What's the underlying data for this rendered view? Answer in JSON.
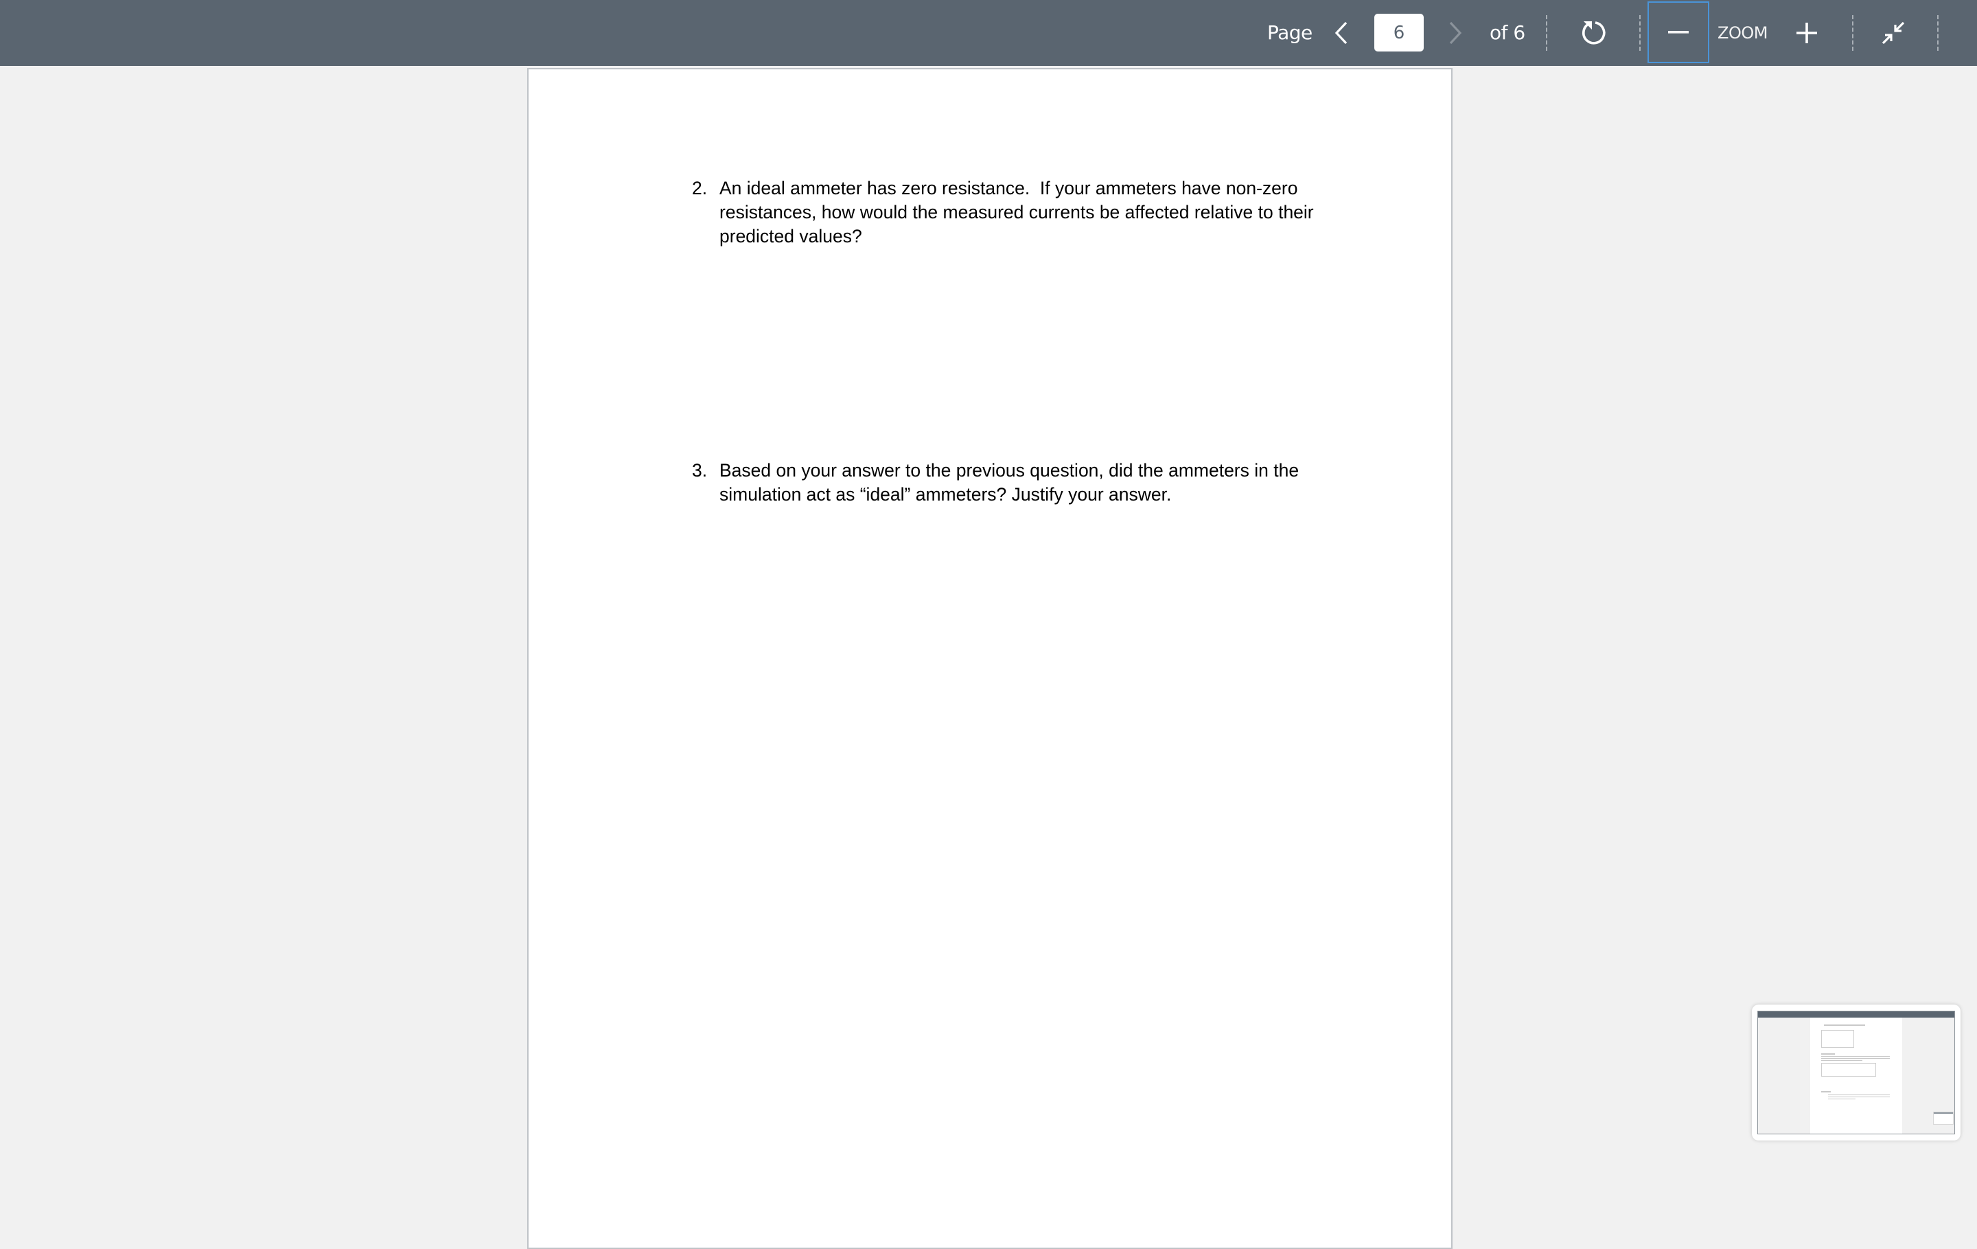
{
  "toolbar": {
    "page_label": "Page",
    "current_page": "6",
    "total_pages_label": "of 6",
    "zoom_label": "ZOOM",
    "icons": {
      "prev": "chevron-left-icon",
      "next": "chevron-right-icon",
      "rotate": "rotate-icon",
      "zoom_out": "minus-icon",
      "zoom_in": "plus-icon",
      "exit_fullscreen": "exit-fullscreen-icon"
    },
    "next_disabled": true,
    "colors": {
      "background": "#5a6570",
      "focus_ring": "#4a94d8",
      "text": "#ffffff"
    }
  },
  "document": {
    "questions": [
      {
        "number": "2.",
        "text": "An ideal ammeter has zero resistance.  If your ammeters have non-zero\nresistances, how would the measured currents be affected relative to their\npredicted values?"
      },
      {
        "number": "3.",
        "text": "Based on your answer to the previous question, did the ammeters in the\nsimulation act as “ideal” ammeters? Justify your answer."
      }
    ]
  },
  "thumbnail": {
    "label": "page-preview-thumbnail"
  }
}
